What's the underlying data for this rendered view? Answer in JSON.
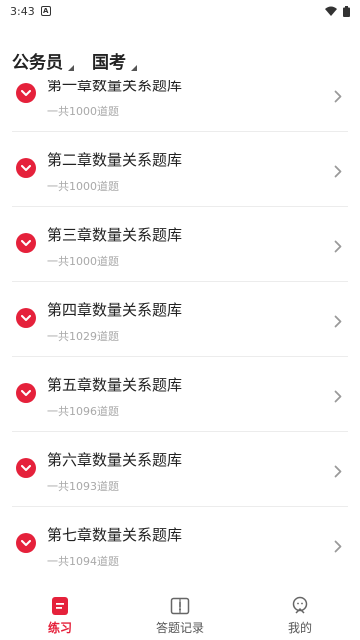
{
  "status_bar": {
    "time": "3:43",
    "notification_icon": "a-icon",
    "wifi_icon": "wifi-icon",
    "battery_icon": "battery-icon"
  },
  "header": {
    "filters": [
      {
        "label": "公务员"
      },
      {
        "label": "国考"
      }
    ]
  },
  "colors": {
    "accent": "#e5213b",
    "subtext": "#a9a9a9",
    "divider": "#ececec"
  },
  "chapters": [
    {
      "title": "第一章数量关系题库",
      "count": "一共1000道题"
    },
    {
      "title": "第二章数量关系题库",
      "count": "一共1000道题"
    },
    {
      "title": "第三章数量关系题库",
      "count": "一共1000道题"
    },
    {
      "title": "第四章数量关系题库",
      "count": "一共1029道题"
    },
    {
      "title": "第五章数量关系题库",
      "count": "一共1096道题"
    },
    {
      "title": "第六章数量关系题库",
      "count": "一共1093道题"
    },
    {
      "title": "第七章数量关系题库",
      "count": "一共1094道题"
    }
  ],
  "tabbar": {
    "tabs": [
      {
        "label": "练习",
        "icon": "practice-icon",
        "active": true
      },
      {
        "label": "答题记录",
        "icon": "record-book-icon",
        "active": false
      },
      {
        "label": "我的",
        "icon": "profile-icon",
        "active": false
      }
    ]
  }
}
